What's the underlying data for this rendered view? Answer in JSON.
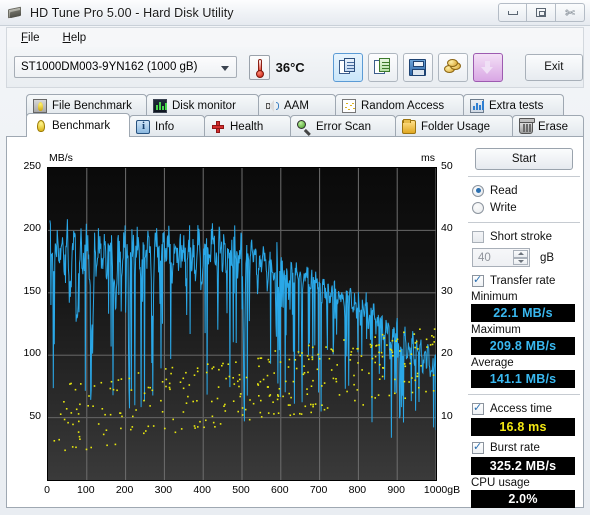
{
  "window": {
    "title": "HD Tune Pro 5.00 - Hard Disk Utility",
    "icon": "hard-disk-icon",
    "minimize": "–",
    "maximize": "□",
    "close": "✕"
  },
  "menu": {
    "items": [
      "File",
      "Help"
    ]
  },
  "toolbar": {
    "drive": "ST1000DM003-9YN162 (1000 gB)",
    "temperature": "36°C",
    "buttons": [
      {
        "name": "copy-to-clipboard-button",
        "icon": "copy-document-icon",
        "selected": true
      },
      {
        "name": "export-excel-button",
        "icon": "copy-green-document-icon",
        "selected": false
      },
      {
        "name": "save-button",
        "icon": "floppy-save-icon",
        "selected": false
      },
      {
        "name": "settings-coins-button",
        "icon": "coins-icon",
        "selected": false
      },
      {
        "name": "download-button",
        "icon": "purple-down-arrow-icon",
        "selected": false
      }
    ],
    "exit_label": "Exit"
  },
  "tabs": {
    "row1": [
      {
        "label": "File Benchmark",
        "icon": "file-benchmark-icon"
      },
      {
        "label": "Disk monitor",
        "icon": "disk-monitor-icon"
      },
      {
        "label": "AAM",
        "icon": "speaker-icon"
      },
      {
        "label": "Random Access",
        "icon": "random-access-icon"
      },
      {
        "label": "Extra tests",
        "icon": "extra-tests-icon"
      }
    ],
    "row2": [
      {
        "label": "Benchmark",
        "icon": "benchmark-bulb-icon",
        "active": true
      },
      {
        "label": "Info",
        "icon": "info-icon",
        "active": false
      },
      {
        "label": "Health",
        "icon": "health-cross-icon",
        "active": false
      },
      {
        "label": "Error Scan",
        "icon": "magnifier-icon",
        "active": false
      },
      {
        "label": "Folder Usage",
        "icon": "folder-icon",
        "active": false
      },
      {
        "label": "Erase",
        "icon": "trash-icon",
        "active": false
      }
    ]
  },
  "panel": {
    "start_label": "Start",
    "mode": [
      {
        "label": "Read",
        "selected": true
      },
      {
        "label": "Write",
        "selected": false
      }
    ],
    "short_stroke": {
      "label": "Short stroke",
      "checked": false
    },
    "short_stroke_size": {
      "value": "40",
      "unit": "gB"
    },
    "transfer_rate": {
      "label": "Transfer rate",
      "checked": true
    },
    "stats": [
      {
        "name": "Minimum",
        "value": "22.1 MB/s",
        "color": "#39b8f0"
      },
      {
        "name": "Maximum",
        "value": "209.8 MB/s",
        "color": "#39b8f0"
      },
      {
        "name": "Average",
        "value": "141.1 MB/s",
        "color": "#39b8f0"
      }
    ],
    "access_time": {
      "label": "Access time",
      "checked": true,
      "value": "16.8 ms",
      "color": "#f2e713"
    },
    "burst_rate": {
      "label": "Burst rate",
      "checked": true,
      "value": "325.2 MB/s",
      "color": "#ffffff"
    },
    "cpu_usage": {
      "label": "CPU usage",
      "value": "2.0%",
      "color": "#ffffff"
    }
  },
  "chart_data": {
    "type": "line",
    "title": "",
    "xlabel": "gB",
    "ylabel": "MB/s",
    "y2label": "ms",
    "xlim": [
      0,
      1000
    ],
    "ylim": [
      0,
      250
    ],
    "y2lim": [
      0,
      50
    ],
    "grid": true,
    "x_ticks": [
      0,
      100,
      200,
      300,
      400,
      500,
      600,
      700,
      800,
      900,
      1000
    ],
    "x_tick_labels": [
      "0",
      "100",
      "200",
      "300",
      "400",
      "500",
      "600",
      "700",
      "800",
      "900",
      "1000gB"
    ],
    "y_ticks": [
      0,
      50,
      100,
      150,
      200,
      250
    ],
    "y_tick_labels": [
      "0",
      "50",
      "100",
      "150",
      "200",
      "250"
    ],
    "y2_ticks": [
      0,
      10,
      20,
      30,
      40,
      50
    ],
    "y2_tick_labels": [
      "0",
      "10",
      "20",
      "30",
      "40",
      "50"
    ],
    "series": [
      {
        "name": "Transfer rate",
        "type": "line",
        "color": "#2aa8e8",
        "axis": "left",
        "units": "MB/s",
        "x": [
          5,
          10,
          15,
          20,
          25,
          30,
          35,
          40,
          45,
          50,
          55,
          60,
          65,
          70,
          75,
          80,
          85,
          90,
          95,
          100,
          105,
          110,
          115,
          120,
          125,
          130,
          135,
          140,
          145,
          150,
          155,
          160,
          165,
          170,
          175,
          180,
          185,
          190,
          195,
          200,
          205,
          210,
          215,
          220,
          225,
          230,
          235,
          240,
          245,
          250,
          255,
          260,
          265,
          270,
          275,
          280,
          285,
          290,
          295,
          300,
          305,
          310,
          315,
          320,
          325,
          330,
          335,
          340,
          345,
          350,
          355,
          360,
          365,
          370,
          375,
          380,
          385,
          390,
          395,
          400,
          405,
          410,
          415,
          420,
          425,
          430,
          435,
          440,
          445,
          450,
          455,
          460,
          465,
          470,
          475,
          480,
          485,
          490,
          495,
          500,
          505,
          510,
          515,
          520,
          525,
          530,
          535,
          540,
          545,
          550,
          555,
          560,
          565,
          570,
          575,
          580,
          585,
          590,
          595,
          600,
          605,
          610,
          615,
          620,
          625,
          630,
          635,
          640,
          645,
          650,
          655,
          660,
          665,
          670,
          675,
          680,
          685,
          690,
          695,
          700,
          705,
          710,
          715,
          720,
          725,
          730,
          735,
          740,
          745,
          750,
          755,
          760,
          765,
          770,
          775,
          780,
          785,
          790,
          795,
          800,
          805,
          810,
          815,
          820,
          825,
          830,
          835,
          840,
          845,
          850,
          855,
          860,
          865,
          870,
          875,
          880,
          885,
          890,
          895,
          900,
          905,
          910,
          915,
          920,
          925,
          930,
          935,
          940,
          945,
          950,
          955,
          960,
          965,
          970,
          975,
          980,
          985,
          990,
          995,
          1000
        ],
        "y": [
          200,
          178,
          168,
          196,
          186,
          175,
          192,
          181,
          170,
          205,
          150,
          162,
          196,
          186,
          130,
          175,
          190,
          168,
          182,
          196,
          176,
          160,
          104,
          188,
          172,
          196,
          186,
          178,
          192,
          170,
          182,
          196,
          188,
          160,
          128,
          196,
          178,
          168,
          186,
          196,
          180,
          150,
          196,
          186,
          170,
          192,
          180,
          165,
          198,
          186,
          178,
          196,
          168,
          115,
          186,
          196,
          178,
          170,
          190,
          186,
          176,
          196,
          182,
          150,
          186,
          196,
          172,
          188,
          176,
          196,
          168,
          186,
          196,
          178,
          190,
          166,
          196,
          186,
          150,
          170,
          188,
          196,
          176,
          186,
          198,
          180,
          168,
          196,
          186,
          178,
          196,
          170,
          186,
          190,
          176,
          196,
          182,
          168,
          186,
          196,
          72,
          178,
          186,
          168,
          190,
          176,
          186,
          150,
          178,
          168,
          186,
          176,
          158,
          170,
          182,
          160,
          172,
          186,
          150,
          178,
          168,
          160,
          172,
          150,
          164,
          178,
          158,
          170,
          160,
          172,
          150,
          166,
          158,
          170,
          148,
          162,
          155,
          168,
          150,
          160,
          145,
          158,
          148,
          162,
          140,
          152,
          146,
          158,
          138,
          150,
          142,
          154,
          136,
          148,
          140,
          150,
          132,
          144,
          136,
          148,
          128,
          140,
          134,
          146,
          125,
          136,
          130,
          142,
          118,
          130,
          124,
          136,
          110,
          124,
          118,
          130,
          104,
          118,
          112,
          124,
          100,
          112,
          106,
          118,
          96,
          108,
          102,
          115,
          94,
          106,
          100,
          112,
          88,
          100,
          94,
          106,
          82,
          94,
          88,
          100,
          76,
          88,
          80,
          92,
          70,
          82,
          74,
          86,
          64,
          76,
          68,
          40
        ]
      },
      {
        "name": "Access time",
        "type": "scatter",
        "color": "#e8e80f",
        "axis": "right",
        "units": "ms",
        "mean_ms": 16.8,
        "point_count": 310,
        "range_ms": [
          4,
          30
        ]
      }
    ]
  }
}
